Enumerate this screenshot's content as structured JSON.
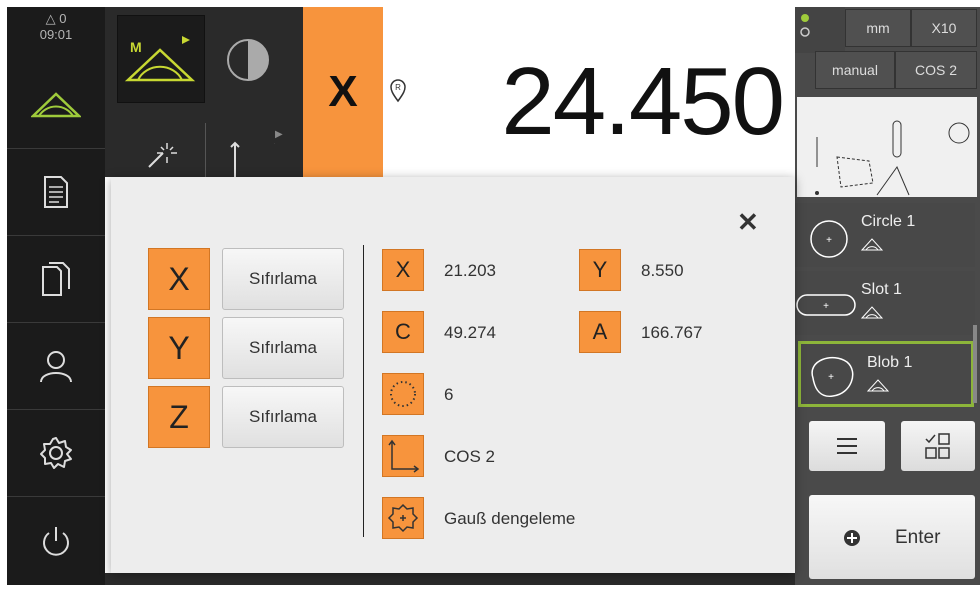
{
  "status": {
    "warnings": "0",
    "time": "09:01"
  },
  "axis": {
    "name": "X",
    "value": "24.450",
    "ref_marker": "R"
  },
  "right_panel": {
    "unit": "mm",
    "zoom": "X10",
    "mode": "manual",
    "coord_system": "COS 2",
    "features": [
      "Circle 1",
      "Slot 1",
      "Blob 1"
    ],
    "enter_label": "Enter"
  },
  "dialog": {
    "axes": [
      {
        "label": "X",
        "reset_label": "Sıfırlama"
      },
      {
        "label": "Y",
        "reset_label": "Sıfırlama"
      },
      {
        "label": "Z",
        "reset_label": "Sıfırlama"
      }
    ],
    "results": {
      "x": {
        "label": "X",
        "value": "21.203"
      },
      "y": {
        "label": "Y",
        "value": "8.550"
      },
      "c": {
        "label": "C",
        "value": "49.274"
      },
      "a": {
        "label": "A",
        "value": "166.767"
      },
      "points": "6",
      "coord_system": "COS 2",
      "fit_method": "Gauß dengeleme"
    },
    "close_icon": "close-icon"
  },
  "colors": {
    "accent": "#f7943d",
    "sidebar": "#1b1b1b",
    "selected": "#8db53a"
  }
}
